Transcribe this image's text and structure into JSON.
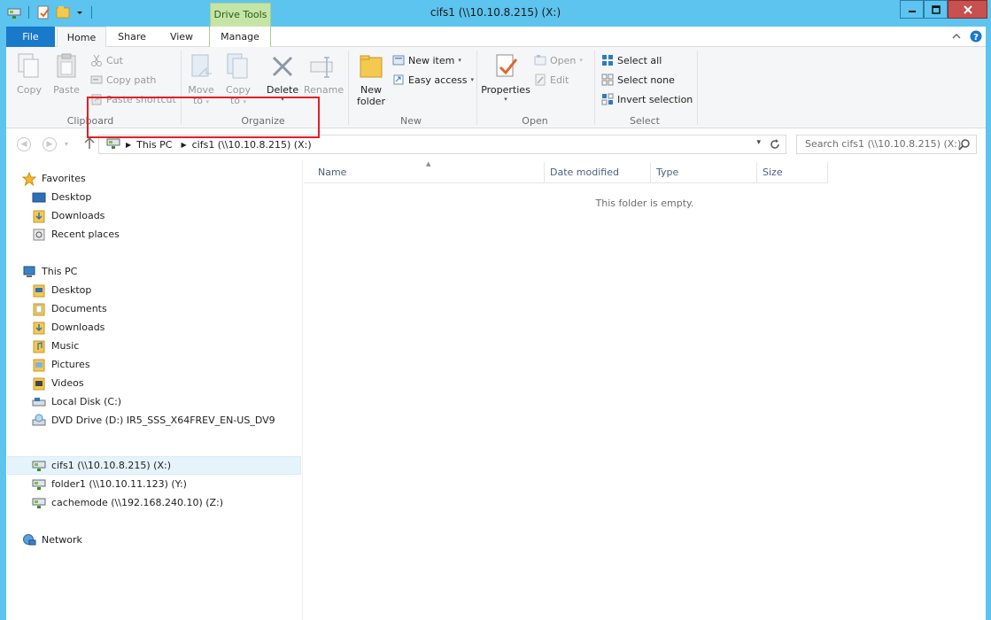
{
  "window": {
    "title": "cifs1 (\\\\10.10.8.215) (X:)",
    "context_tab_group": "Drive Tools"
  },
  "ribbon": {
    "tabs": [
      "File",
      "Home",
      "Share",
      "View",
      "Manage"
    ],
    "clipboard": {
      "label": "Clipboard",
      "copy": "Copy",
      "paste": "Paste",
      "cut": "Cut",
      "copy_path": "Copy path",
      "paste_shortcut": "Paste shortcut"
    },
    "organize": {
      "label": "Organize",
      "move_to": "Move",
      "move_to_2": "to",
      "copy_to": "Copy",
      "copy_to_2": "to",
      "delete": "Delete",
      "rename": "Rename"
    },
    "new": {
      "label": "New",
      "new_folder": "New",
      "new_folder_2": "folder",
      "new_item": "New item",
      "easy_access": "Easy access"
    },
    "open": {
      "label": "Open",
      "properties": "Properties",
      "open": "Open",
      "edit": "Edit"
    },
    "select": {
      "label": "Select",
      "select_all": "Select all",
      "select_none": "Select none",
      "invert_selection": "Invert selection"
    }
  },
  "address": {
    "crumbs": [
      "This PC",
      "cifs1 (\\\\10.10.8.215) (X:)"
    ],
    "search_placeholder": "Search cifs1 (\\\\10.10.8.215) (X:)"
  },
  "nav": {
    "favorites": {
      "label": "Favorites",
      "items": [
        "Desktop",
        "Downloads",
        "Recent places"
      ]
    },
    "this_pc": {
      "label": "This PC",
      "items": [
        "Desktop",
        "Documents",
        "Downloads",
        "Music",
        "Pictures",
        "Videos",
        "Local Disk (C:)",
        "DVD Drive (D:) IR5_SSS_X64FREV_EN-US_DV9",
        "cifs1 (\\\\10.10.8.215) (X:)",
        "folder1 (\\\\10.10.11.123) (Y:)",
        "cachemode (\\\\192.168.240.10) (Z:)"
      ]
    },
    "network": "Network"
  },
  "content": {
    "columns": [
      "Name",
      "Date modified",
      "Type",
      "Size"
    ],
    "empty_message": "This folder is empty."
  }
}
